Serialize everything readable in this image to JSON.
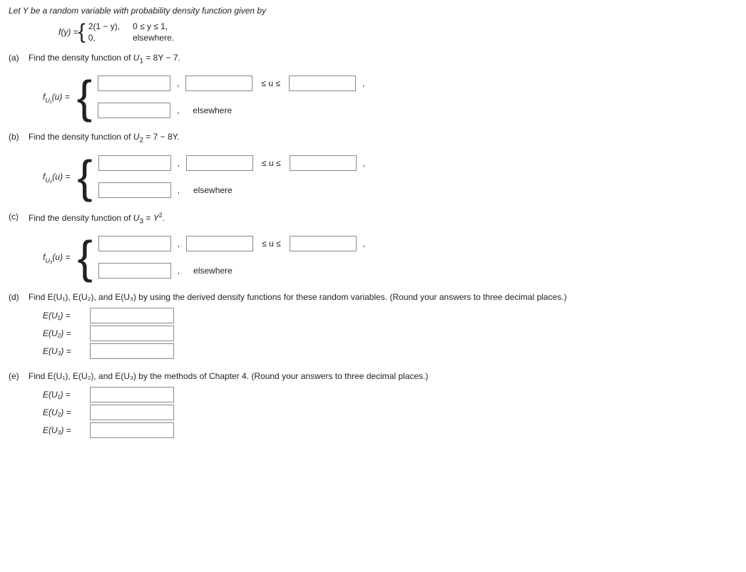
{
  "intro": "Let Y be a random variable with probability density function given by",
  "pdf_prefix": "f(y) = ",
  "pdf": {
    "line1_expr": "2(1 − y),",
    "line1_cond": "0 ≤ y ≤ 1,",
    "line2_expr": "0,",
    "line2_cond": "elsewhere."
  },
  "parts": {
    "a": {
      "label": "(a)",
      "prompt_pre": "Find the density function of ",
      "var": "U",
      "sub": "1",
      "prompt_post": " = 8Y − 7."
    },
    "b": {
      "label": "(b)",
      "prompt_pre": "Find the density function of ",
      "var": "U",
      "sub": "2",
      "prompt_post": " = 7 − 8Y."
    },
    "c": {
      "label": "(c)",
      "prompt_pre": "Find the density function of ",
      "var": "U",
      "sub": "3",
      "prompt_post_pre": " = ",
      "prompt_post_var": "Y",
      "prompt_post_sup": "2",
      "prompt_post_end": "."
    },
    "d": {
      "label": "(d)",
      "prompt": "Find E(U₁), E(U₂), and E(U₃) by using the derived density functions for these random variables. (Round your answers to three decimal places.)"
    },
    "e": {
      "label": "(e)",
      "prompt": "Find E(U₁), E(U₂), and E(U₃) by the methods of Chapter 4. (Round your answers to three decimal places.)"
    }
  },
  "fn_labels": {
    "a_pre": "f",
    "a_sub": "U₁",
    "a_arg": "(u) = ",
    "b_pre": "f",
    "b_sub": "U₂",
    "b_arg": "(u) = ",
    "c_pre": "f",
    "c_sub": "U₃",
    "c_arg": "(u) = "
  },
  "tokens": {
    "comma": ",",
    "sus": "≤ u ≤",
    "elsewhere": "elsewhere"
  },
  "ev": {
    "u1": "E(U₁)  =",
    "u2": "E(U₂)  =",
    "u3": "E(U₃)  ="
  }
}
